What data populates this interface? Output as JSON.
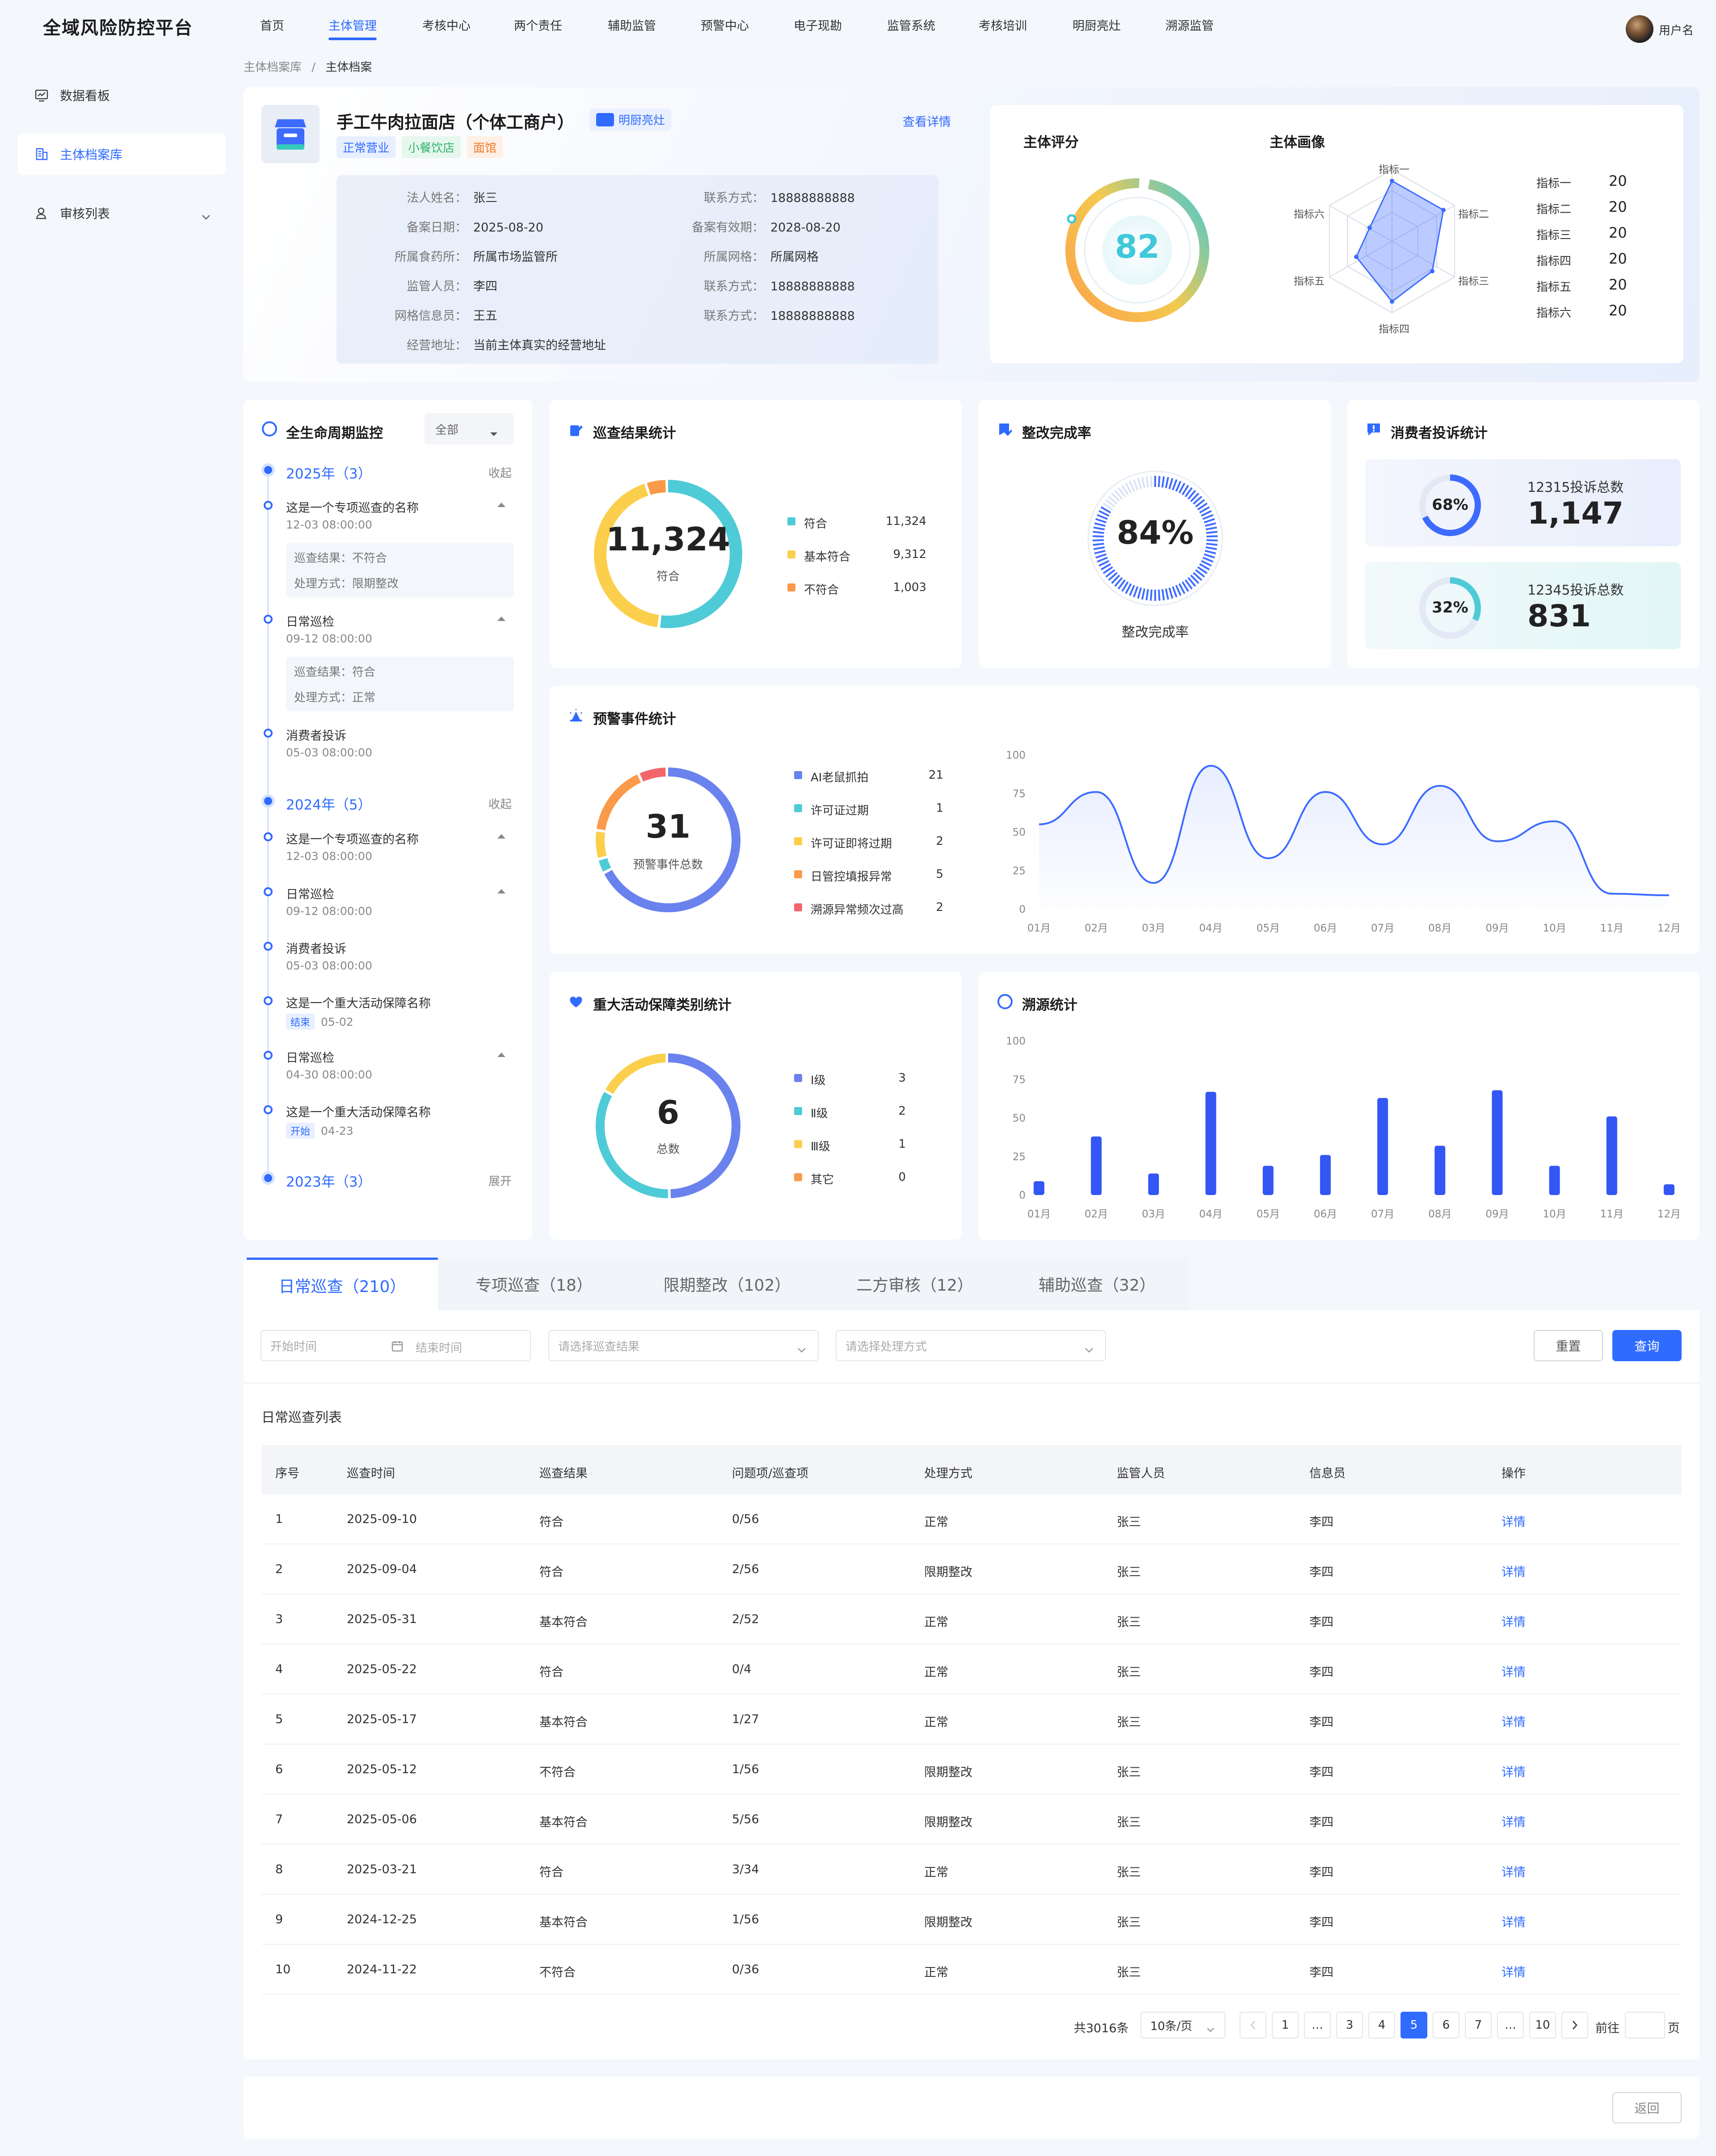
{
  "app": {
    "title": "全域风险防控平台",
    "user": "用户名"
  },
  "nav": [
    "首页",
    "主体管理",
    "考核中心",
    "两个责任",
    "辅助监管",
    "预警中心",
    "电子现勘",
    "监管系统",
    "考核培训",
    "明厨亮灶",
    "溯源监管"
  ],
  "nav_active": 1,
  "sidebar": [
    {
      "label": "数据看板",
      "icon": "chart-icon"
    },
    {
      "label": "主体档案库",
      "icon": "building-icon"
    },
    {
      "label": "审核列表",
      "icon": "user-icon"
    }
  ],
  "breadcrumb": [
    "主体档案库",
    "/",
    "主体档案"
  ],
  "entity": {
    "name": "手工牛肉拉面店（个体工商户）",
    "badge": "明厨亮灶",
    "tags": [
      "正常营业",
      "小餐饮店",
      "面馆"
    ],
    "detail_link": "查看详情",
    "fields": [
      {
        "k": "法人姓名：",
        "v": "张三"
      },
      {
        "k": "联系方式：",
        "v": "18888888888"
      },
      {
        "k": "备案日期：",
        "v": "2025-08-20"
      },
      {
        "k": "备案有效期：",
        "v": "2028-08-20"
      },
      {
        "k": "所属食药所：",
        "v": "所属市场监管所"
      },
      {
        "k": "所属网格：",
        "v": "所属网格"
      },
      {
        "k": "监管人员：",
        "v": "李四"
      },
      {
        "k": "联系方式：",
        "v": "18888888888"
      },
      {
        "k": "网格信息员：",
        "v": "王五"
      },
      {
        "k": "联系方式：",
        "v": "18888888888"
      },
      {
        "k": "经营地址：",
        "v": "当前主体真实的经营地址"
      }
    ]
  },
  "score": {
    "title": "主体评分",
    "value": "82"
  },
  "portrait": {
    "title": "主体画像",
    "axes": [
      "指标一",
      "指标二",
      "指标三",
      "指标四",
      "指标五",
      "指标六"
    ],
    "values": [
      20,
      20,
      20,
      20,
      20,
      20
    ]
  },
  "lifecycle": {
    "title": "全生命周期监控",
    "filter": "全部",
    "years": [
      {
        "label": "2025年（3）",
        "action": "收起"
      },
      {
        "label": "2024年（5）",
        "action": "收起"
      },
      {
        "label": "2023年（3）",
        "action": "展开"
      }
    ],
    "items2025": [
      {
        "title": "这是一个专项巡查的名称",
        "time": "12-03 08:00:00",
        "r1": "巡查结果：不符合",
        "r2": "处理方式：限期整改"
      },
      {
        "title": "日常巡检",
        "time": "09-12 08:00:00",
        "r1": "巡查结果：符合",
        "r2": "处理方式：正常"
      },
      {
        "title": "消费者投诉",
        "time": "05-03 08:00:00"
      }
    ],
    "items2024": [
      {
        "title": "这是一个专项巡查的名称",
        "time": "12-03 08:00:00"
      },
      {
        "title": "日常巡检",
        "time": "09-12 08:00:00"
      },
      {
        "title": "消费者投诉",
        "time": "05-03 08:00:00"
      },
      {
        "title": "这是一个重大活动保障名称",
        "tag": "结束",
        "time": "05-02"
      },
      {
        "title": "日常巡检",
        "time": "04-30 08:00:00"
      },
      {
        "title": "这是一个重大活动保障名称",
        "tag": "开始",
        "time": "04-23"
      }
    ]
  },
  "inspection": {
    "title": "巡查结果统计",
    "center_value": "11,324",
    "center_label": "符合",
    "items": [
      {
        "name": "符合",
        "value": "11,324",
        "color": "#4ecbd6"
      },
      {
        "name": "基本符合",
        "value": "9,312",
        "color": "#fbcf4b"
      },
      {
        "name": "不符合",
        "value": "1,003",
        "color": "#fa9a4a"
      }
    ]
  },
  "rectify": {
    "title": "整改完成率",
    "value": "84%",
    "label": "整改完成率",
    "rate": 0.84
  },
  "complaints": {
    "title": "消费者投诉统计",
    "items": [
      {
        "pct": "68%",
        "rate": 0.68,
        "label": "12315投诉总数",
        "value": "1,147",
        "color": "#3d6bff"
      },
      {
        "pct": "32%",
        "rate": 0.32,
        "label": "12345投诉总数",
        "value": "831",
        "color": "#4ecbd6"
      }
    ]
  },
  "warning": {
    "title": "预警事件统计",
    "center_value": "31",
    "center_label": "预警事件总数",
    "items": [
      {
        "name": "AI老鼠抓拍",
        "value": "21",
        "color": "#6a82ee"
      },
      {
        "name": "许可证过期",
        "value": "1",
        "color": "#4ecbd6"
      },
      {
        "name": "许可证即将过期",
        "value": "2",
        "color": "#fbcf4b"
      },
      {
        "name": "日管控填报异常",
        "value": "5",
        "color": "#fa9a4a"
      },
      {
        "name": "溯源异常频次过高",
        "value": "2",
        "color": "#f2666b"
      }
    ]
  },
  "activity": {
    "title": "重大活动保障类别统计",
    "center_value": "6",
    "center_label": "总数",
    "items": [
      {
        "name": "Ⅰ级",
        "value": "3",
        "color": "#6a82ee"
      },
      {
        "name": "Ⅱ级",
        "value": "2",
        "color": "#4ecbd6"
      },
      {
        "name": "Ⅲ级",
        "value": "1",
        "color": "#fbcf4b"
      },
      {
        "name": "其它",
        "value": "0",
        "color": "#fa9a4a"
      }
    ]
  },
  "chart_data": [
    {
      "type": "line",
      "categories": [
        "01月",
        "02月",
        "03月",
        "04月",
        "05月",
        "06月",
        "07月",
        "08月",
        "09月",
        "10月",
        "11月",
        "12月"
      ],
      "values": [
        55,
        76,
        17,
        93,
        33,
        76,
        42,
        80,
        44,
        57,
        10,
        null
      ],
      "ylim": [
        0,
        100
      ],
      "yticks": [
        "100",
        "75",
        "50",
        "25",
        "0"
      ]
    },
    {
      "type": "bar",
      "title": "溯源统计",
      "categories": [
        "01月",
        "02月",
        "03月",
        "04月",
        "05月",
        "06月",
        "07月",
        "08月",
        "09月",
        "10月",
        "11月",
        "12月"
      ],
      "values": [
        9,
        38,
        14,
        67,
        19,
        26,
        63,
        32,
        68,
        19,
        51,
        7
      ],
      "ylim": [
        0,
        100
      ],
      "yticks": [
        "100",
        "75",
        "50",
        "25",
        "0"
      ]
    }
  ],
  "tabs": [
    "日常巡查（210）",
    "专项巡查（18）",
    "限期整改（102）",
    "二方审核（12）",
    "辅助巡查（32）"
  ],
  "filters": {
    "start": "开始时间",
    "end": "结束时间",
    "result": "请选择巡查结果",
    "method": "请选择处理方式",
    "reset": "重置",
    "query": "查询"
  },
  "table": {
    "title": "日常巡查列表",
    "headers": [
      "序号",
      "巡查时间",
      "巡查结果",
      "问题项/巡查项",
      "处理方式",
      "监管人员",
      "信息员",
      "操作"
    ],
    "rows": [
      [
        "1",
        "2025-09-10",
        "符合",
        "0/56",
        "正常",
        "张三",
        "李四",
        "详情"
      ],
      [
        "2",
        "2025-09-04",
        "符合",
        "2/56",
        "限期整改",
        "张三",
        "李四",
        "详情"
      ],
      [
        "3",
        "2025-05-31",
        "基本符合",
        "2/52",
        "正常",
        "张三",
        "李四",
        "详情"
      ],
      [
        "4",
        "2025-05-22",
        "符合",
        "0/4",
        "正常",
        "张三",
        "李四",
        "详情"
      ],
      [
        "5",
        "2025-05-17",
        "基本符合",
        "1/27",
        "正常",
        "张三",
        "李四",
        "详情"
      ],
      [
        "6",
        "2025-05-12",
        "不符合",
        "1/56",
        "限期整改",
        "张三",
        "李四",
        "详情"
      ],
      [
        "7",
        "2025-05-06",
        "基本符合",
        "5/56",
        "限期整改",
        "张三",
        "李四",
        "详情"
      ],
      [
        "8",
        "2025-03-21",
        "符合",
        "3/34",
        "正常",
        "张三",
        "李四",
        "详情"
      ],
      [
        "9",
        "2024-12-25",
        "基本符合",
        "1/56",
        "限期整改",
        "张三",
        "李四",
        "详情"
      ],
      [
        "10",
        "2024-11-22",
        "不符合",
        "0/36",
        "正常",
        "张三",
        "李四",
        "详情"
      ]
    ]
  },
  "pagination": {
    "total": "共3016条",
    "size": "10条/页",
    "pages": [
      "1",
      "…",
      "3",
      "4",
      "5",
      "6",
      "7",
      "…",
      "10"
    ],
    "current": "5",
    "goto": "前往",
    "page_unit": "页"
  },
  "back": "返回"
}
